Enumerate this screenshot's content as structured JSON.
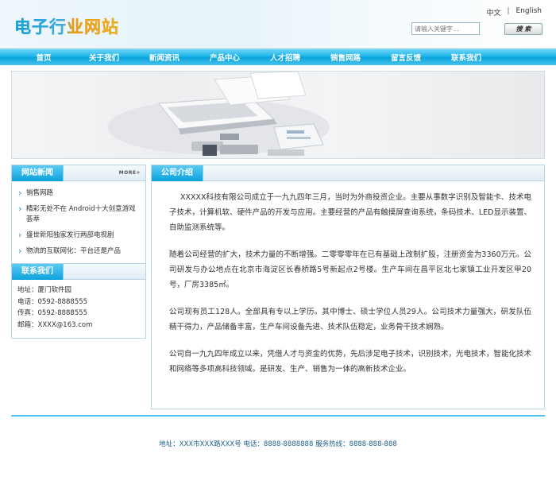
{
  "header": {
    "logo_text": "电子行业网站",
    "lang_cn": "中文",
    "lang_sep": "|",
    "lang_en": "English",
    "search_placeholder": "请输入关键字...",
    "search_button": "搜 索"
  },
  "nav": {
    "items": [
      "首页",
      "关于我们",
      "新闻资讯",
      "产品中心",
      "人才招聘",
      "销售网路",
      "留言反馈",
      "联系我们"
    ]
  },
  "sidebar": {
    "news_title": "网站新闻",
    "more_label": "MORE+",
    "news_items": [
      "销售网路",
      "精彩无处不在 Android十大创意游戏荟萃",
      "盛世新阳独家发行两部电视剧",
      "物流的互联网化：平台还是产品"
    ],
    "contact_title": "联系我们",
    "contact_lines": [
      "地址：厦门软件园",
      "电话：0592-8888555",
      "传真：0592-8888555",
      "邮箱：XXXX@163.com"
    ]
  },
  "main": {
    "title": "公司介绍",
    "paragraphs": [
      "XXXXX科技有限公司成立于一九九四年三月，当时为外商投资企业。主要从事数字识别及智能卡、技术电子技术，计算机软、硬件产品的开发与应用。主要经营的产品有触摸屏查询系统，条码技术、LED显示装置、自助监测系统等。",
      "随着公司经营的扩大，技术力量的不断增强。二零零零年在已有基础上改制扩股，注册资金为3360万元。公司研发与办公地点在北京市海淀区长春桥路5号新起点2号楼。生产车间在昌平区北七家镇工业开发区甲20号，厂房3385㎡。",
      "公司现有员工128人。全部具有专以上学历。其中博士、硕士学位人员29人。公司技术力量强大，研发队伍精干得力，产品储备丰富，生产车间设备先进、技术队伍稳定，业务骨干技术娴熟。",
      "公司自一九九四年成立以来，凭借人才与资金的优势，先后涉足电子技术，识别技术，光电技术，智能化技术和网络等多项高科技领域。是研发、生产、销售为一体的高新技术企业。"
    ]
  },
  "footer": {
    "text": "地址：XXX市XXX路XXX号 电话：8888-8888888 服务热线：8888-888-888"
  }
}
